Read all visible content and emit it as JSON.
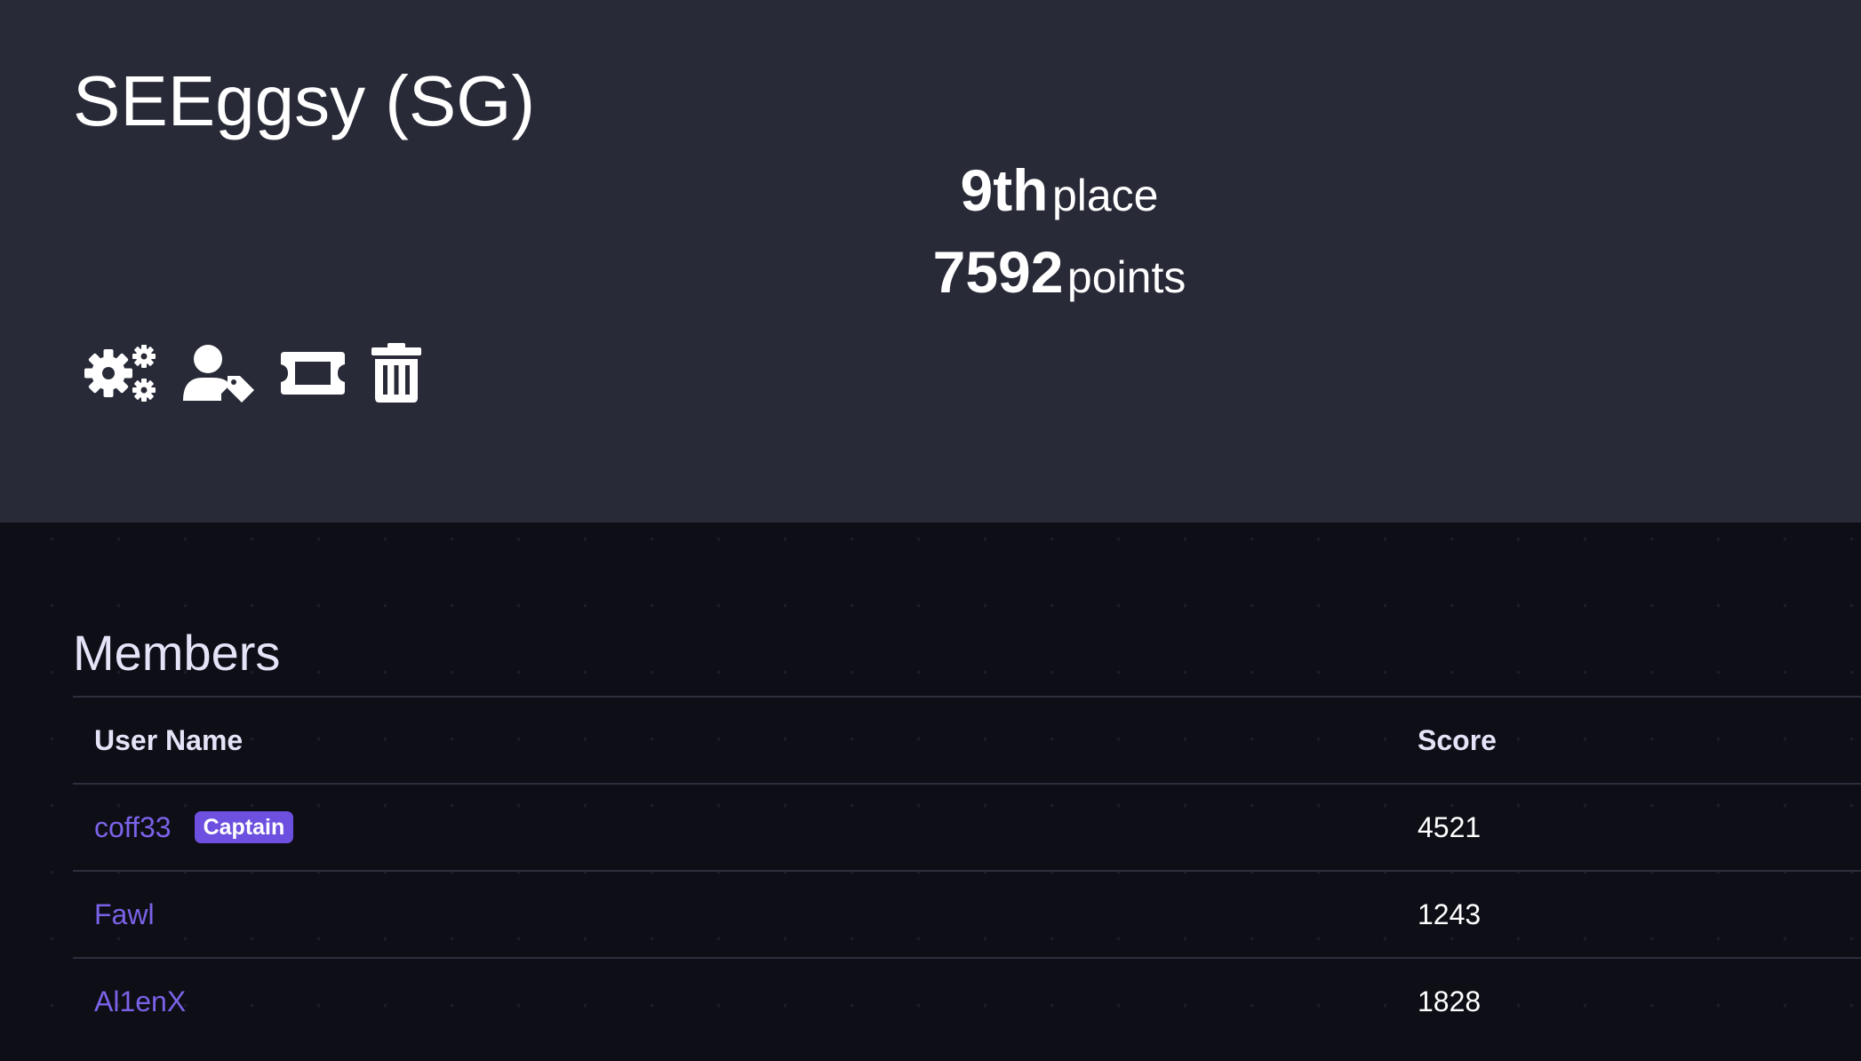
{
  "team": {
    "name": "SEEggsy (SG)",
    "place_number": "9th",
    "place_word": "place",
    "points_number": "7592",
    "points_word": "points"
  },
  "actions": [
    {
      "icon": "gears-icon"
    },
    {
      "icon": "user-tag-icon"
    },
    {
      "icon": "ticket-icon"
    },
    {
      "icon": "trash-icon"
    }
  ],
  "members": {
    "title": "Members",
    "columns": {
      "name": "User Name",
      "score": "Score"
    },
    "rows": [
      {
        "name": "coff33",
        "badge": "Captain",
        "score": "4521"
      },
      {
        "name": "Fawl",
        "badge": "",
        "score": "1243"
      },
      {
        "name": "Al1enX",
        "badge": "",
        "score": "1828"
      }
    ]
  },
  "colors": {
    "header_bg": "#282a37",
    "page_bg": "#0d0e16",
    "link": "#7b62e8",
    "badge": "#6d50df"
  }
}
